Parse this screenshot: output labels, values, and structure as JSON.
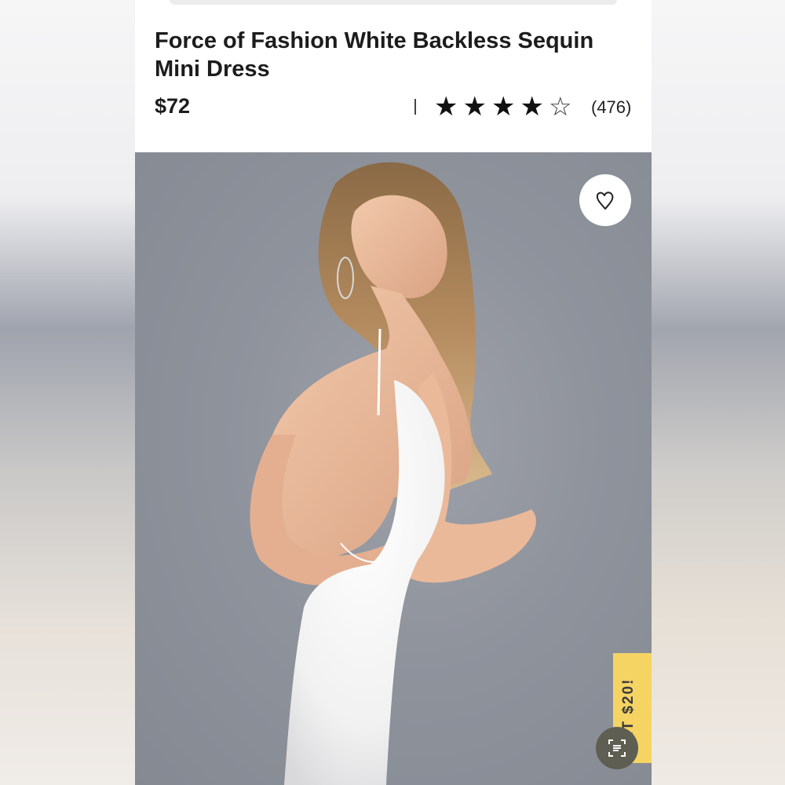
{
  "product": {
    "title": "Force of Fashion White Backless Sequin Mini Dress",
    "price": "$72",
    "rating": 4,
    "rating_max": 5,
    "rating_separator": "|",
    "review_count": "(476)"
  },
  "image": {
    "favorite_icon": "heart-outline-icon",
    "promo_label": "GET $20!",
    "scan_icon": "scan-text-icon"
  },
  "colors": {
    "page_bg": "#ffffff",
    "text": "#1c1c1c",
    "promo_bg": "#f6d463",
    "hero_bg": "#8f939c"
  }
}
